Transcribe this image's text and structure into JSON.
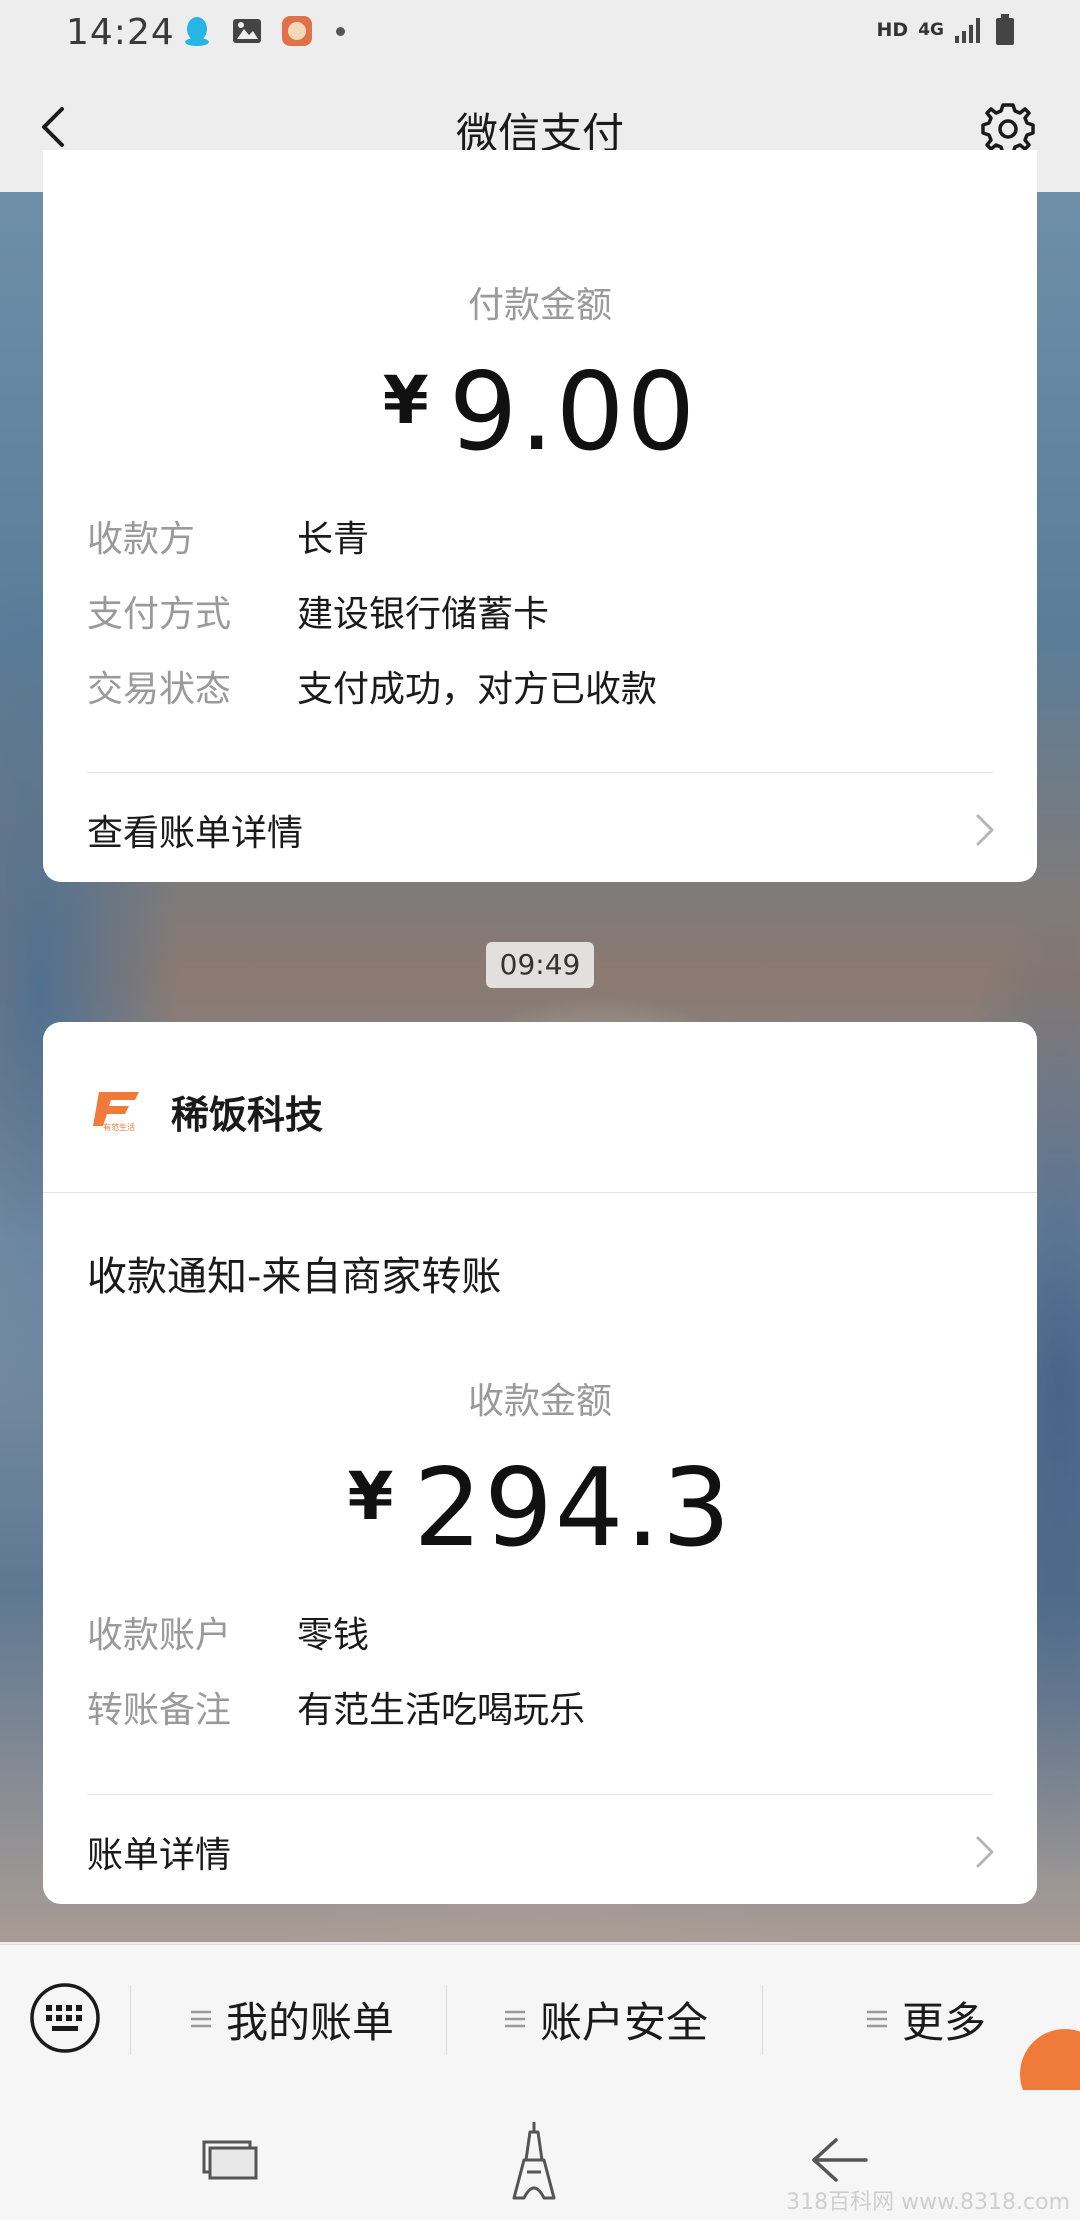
{
  "status_bar": {
    "time": "14:24",
    "hd": "HD",
    "network": "4G"
  },
  "header": {
    "title": "微信支付"
  },
  "card1": {
    "amount_label": "付款金额",
    "currency": "¥",
    "amount": "9.00",
    "rows": [
      {
        "key": "收款方",
        "value": "长青"
      },
      {
        "key": "支付方式",
        "value": "建设银行储蓄卡"
      },
      {
        "key": "交易状态",
        "value": "支付成功，对方已收款"
      }
    ],
    "link": "查看账单详情"
  },
  "timestamp": "09:49",
  "card2": {
    "merchant_name": "稀饭科技",
    "merchant_logo_text": "有范生活",
    "title": "收款通知-来自商家转账",
    "amount_label": "收款金额",
    "currency": "¥",
    "amount": "294.3",
    "rows": [
      {
        "key": "收款账户",
        "value": "零钱"
      },
      {
        "key": "转账备注",
        "value": "有范生活吃喝玩乐"
      }
    ],
    "link": "账单详情"
  },
  "menu": {
    "items": [
      {
        "label": "我的账单"
      },
      {
        "label": "账户安全"
      },
      {
        "label": "更多"
      }
    ]
  },
  "watermark": "318百科网 www.8318.com",
  "colors": {
    "brand_orange": "#f07a3a",
    "text_primary": "#1a1a1a",
    "text_secondary": "#9a9a9a"
  },
  "icons": {
    "status_left": [
      "qq-icon",
      "gallery-icon",
      "app-icon"
    ],
    "nav": [
      "recent-apps-icon",
      "home-icon",
      "back-icon"
    ]
  }
}
